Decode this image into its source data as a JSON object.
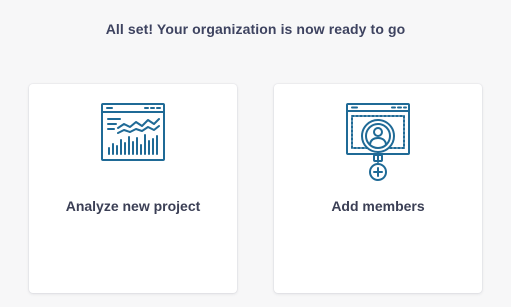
{
  "header": {
    "title": "All set! Your organization is now ready to go"
  },
  "cards": [
    {
      "label": "Analyze new project",
      "icon": "analytics-chart-icon"
    },
    {
      "label": "Add members",
      "icon": "add-member-icon"
    }
  ],
  "colors": {
    "icon": "#1f6a96",
    "background": "#f7f7f8",
    "card": "#ffffff",
    "text": "#3b3f55"
  }
}
